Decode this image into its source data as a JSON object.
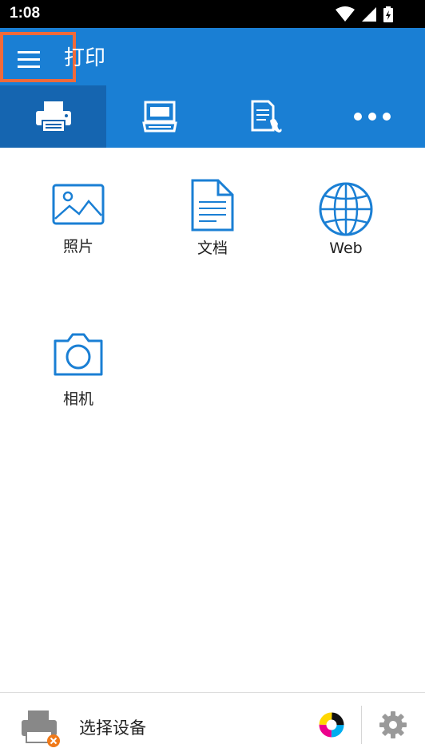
{
  "status": {
    "time": "1:08"
  },
  "appbar": {
    "title": "打印"
  },
  "tabs": [
    {
      "icon": "printer-icon"
    },
    {
      "icon": "scanner-icon"
    },
    {
      "icon": "fax-document-icon"
    },
    {
      "icon": "more-dots-icon"
    }
  ],
  "tiles": [
    {
      "label": "照片",
      "icon": "photo-icon"
    },
    {
      "label": "文档",
      "icon": "document-icon"
    },
    {
      "label": "Web",
      "icon": "globe-icon"
    },
    {
      "label": "相机",
      "icon": "camera-icon"
    }
  ],
  "bottom": {
    "device_label": "选择设备"
  },
  "colors": {
    "primary": "#1a7fd4",
    "active_tab": "#1565b0",
    "highlight": "#f06a3a"
  }
}
